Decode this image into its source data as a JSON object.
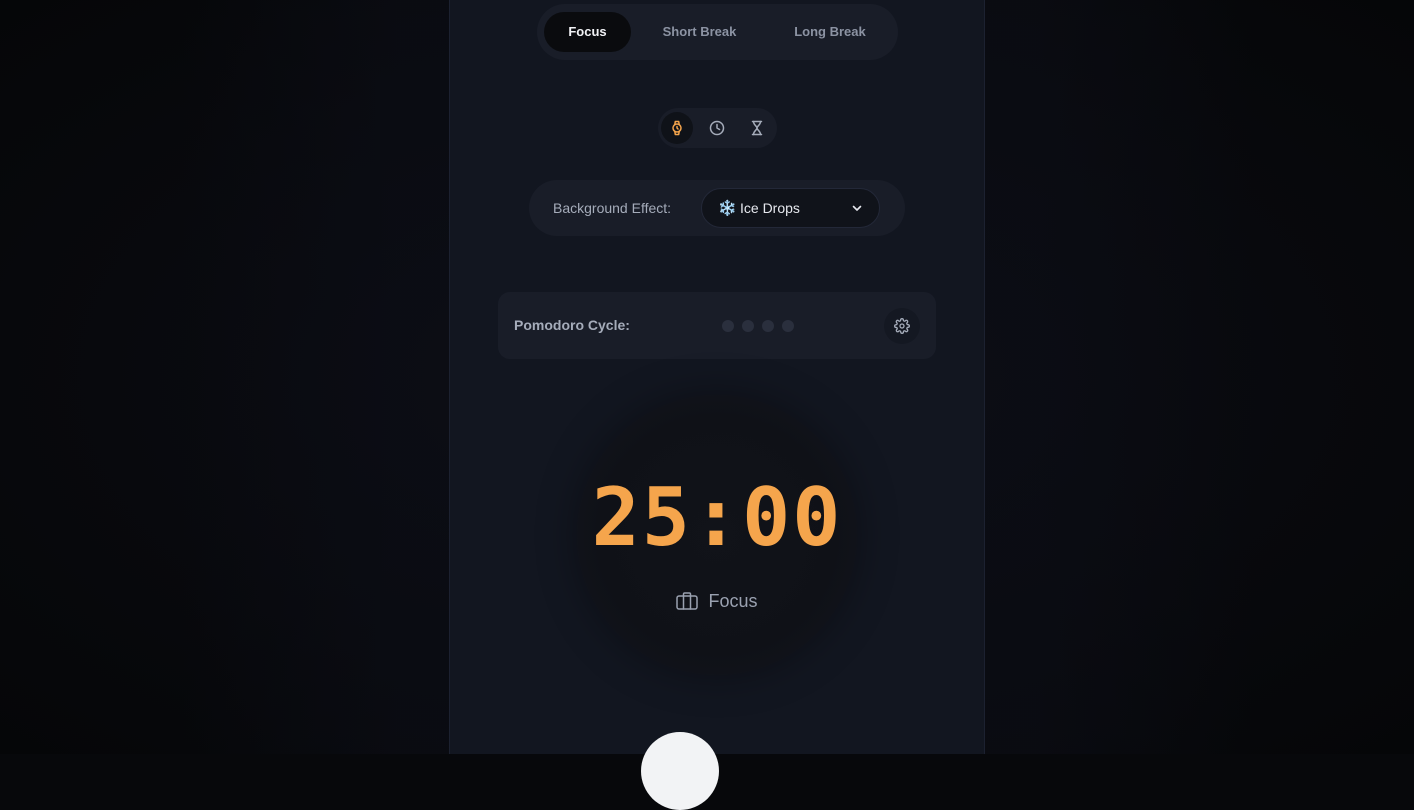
{
  "modes": {
    "tabs": [
      {
        "label": "Focus",
        "active": true
      },
      {
        "label": "Short Break",
        "active": false
      },
      {
        "label": "Long Break",
        "active": false
      }
    ]
  },
  "timer_style": {
    "options": [
      {
        "icon": "watch-icon",
        "active": true
      },
      {
        "icon": "clock-icon",
        "active": false
      },
      {
        "icon": "hourglass-icon",
        "active": false
      }
    ]
  },
  "background_effect": {
    "label": "Background Effect:",
    "emoji": "❄️",
    "value": "Ice Drops"
  },
  "pomodoro_cycle": {
    "label": "Pomodoro Cycle:",
    "completed": 0,
    "total": 4
  },
  "timer": {
    "value": "25:00",
    "mode_label": "Focus"
  },
  "colors": {
    "accent": "#f5a54c",
    "panel": "#121620",
    "card": "#191d28"
  }
}
